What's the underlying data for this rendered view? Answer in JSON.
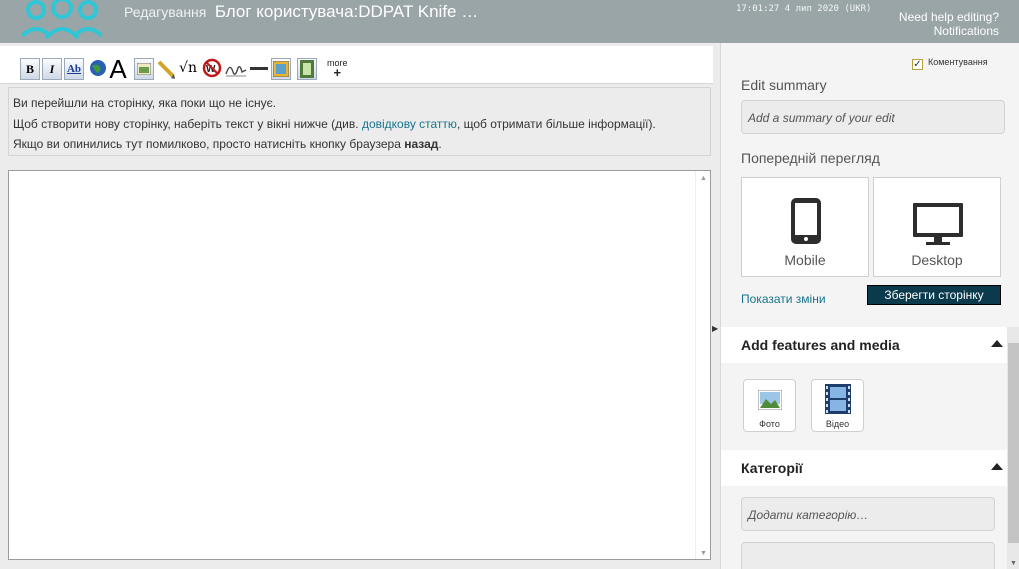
{
  "header": {
    "prefix": "Редагування",
    "title": "Блог користувача:DDPAT Knife …",
    "timestamp": "17:01:27 4 лип 2020 (UKR)",
    "help_link": "Need help editing?",
    "notifications_link": "Notifications"
  },
  "toolbar": {
    "more_label": "more",
    "more_plus": "+",
    "buttons": [
      "B",
      "I",
      "Ab",
      "A"
    ]
  },
  "notice": {
    "line1": "Ви перейшли на сторінку, яка поки що не існує.",
    "line2_pre": "Щоб створити нову сторінку, наберіть текст у вікні нижче (див.",
    "line2_link": "довідкову статтю",
    "line2_post": ", щоб отримати більше інформації).",
    "line3_pre": "Якщо ви опинились тут помилково, просто натисніть кнопку браузера",
    "line3_bold": "назад",
    "line3_post": "."
  },
  "panel": {
    "watch_label": "Коментування",
    "edit_summary_label": "Edit summary",
    "edit_summary_placeholder": "Add a summary of your edit",
    "preview_label": "Попередній перегляд",
    "mobile_label": "Mobile",
    "desktop_label": "Desktop",
    "show_changes": "Показати зміни",
    "save_button": "Зберегти сторінку",
    "features_title": "Add features and media",
    "photo_label": "Фото",
    "video_label": "Відео",
    "categories_title": "Категорії",
    "categories_placeholder": "Додати категорію…"
  }
}
